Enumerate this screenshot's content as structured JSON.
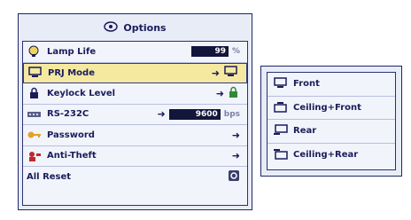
{
  "menu": {
    "title": "Options",
    "items": [
      {
        "label": "Lamp Life",
        "value": "99",
        "unit": "%"
      },
      {
        "label": "PRJ Mode",
        "arrow": "➜"
      },
      {
        "label": "Keylock Level",
        "arrow": "➜"
      },
      {
        "label": "RS-232C",
        "arrow": "➜",
        "value": "9600",
        "unit": "bps"
      },
      {
        "label": "Password",
        "arrow": "➜"
      },
      {
        "label": "Anti-Theft",
        "arrow": "➜"
      },
      {
        "label": "All Reset"
      }
    ]
  },
  "submenu": {
    "items": [
      {
        "label": "Front"
      },
      {
        "label": "Ceiling+Front"
      },
      {
        "label": "Rear"
      },
      {
        "label": "Ceiling+Rear"
      }
    ]
  },
  "colors": {
    "border": "#1f2566",
    "selected_bg": "#f5e9a0",
    "panel_bg": "#e8ecf7"
  }
}
